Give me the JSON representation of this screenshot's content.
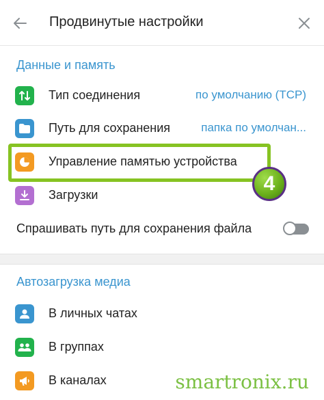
{
  "header": {
    "title": "Продвинутые настройки"
  },
  "sections": {
    "data_memory": {
      "title": "Данные и память",
      "items": [
        {
          "label": "Тип соединения",
          "value": "по умолчанию (TCP)",
          "icon": "arrows-updown-icon",
          "color": "#22b24c"
        },
        {
          "label": "Путь для сохранения",
          "value": "папка по умолчан...",
          "icon": "folder-icon",
          "color": "#3a95cf"
        },
        {
          "label": "Управление памятью устройства",
          "icon": "pie-chart-icon",
          "color": "#f39a22"
        },
        {
          "label": "Загрузки",
          "icon": "download-icon",
          "color": "#b36fd1"
        }
      ],
      "ask_path": {
        "label": "Спрашивать путь для сохранения файла",
        "enabled": false
      }
    },
    "autodownload": {
      "title": "Автозагрузка медиа",
      "items": [
        {
          "label": "В личных чатах",
          "icon": "person-icon",
          "color": "#3a95cf"
        },
        {
          "label": "В группах",
          "icon": "group-icon",
          "color": "#22b24c"
        },
        {
          "label": "В каналах",
          "icon": "megaphone-icon",
          "color": "#f39a22"
        }
      ]
    }
  },
  "annotation": {
    "step": "4",
    "highlight_color": "#86c322"
  },
  "watermark": "smartronix.ru",
  "colors": {
    "accent": "#3a95cf"
  }
}
